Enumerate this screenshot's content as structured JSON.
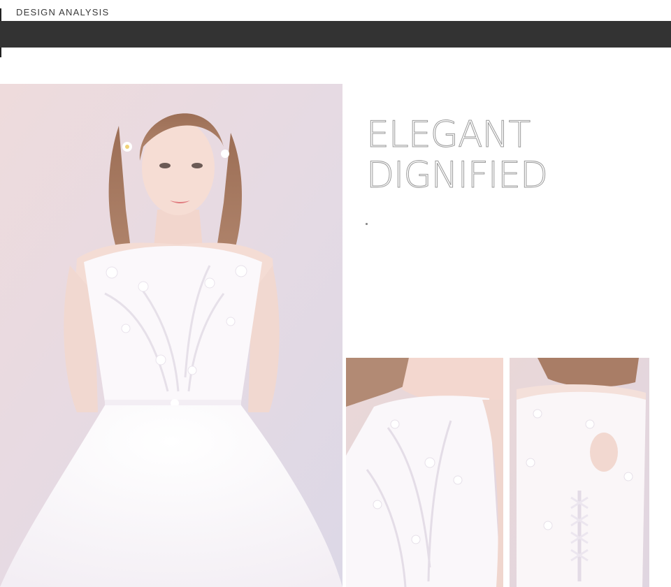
{
  "header": {
    "section_label": "DESIGN ANALYSIS"
  },
  "headline": {
    "line1": "ELEGANT",
    "line2": "DIGNIFIED"
  },
  "colors": {
    "header_bar": "#333333",
    "headline_outline": "#9a9a9a",
    "background": "#ffffff"
  },
  "photos": {
    "main": "bride-in-white-lace-ball-gown",
    "front_detail": "lace-bodice-front-detail",
    "back_detail": "keyhole-back-lace-up-detail"
  }
}
